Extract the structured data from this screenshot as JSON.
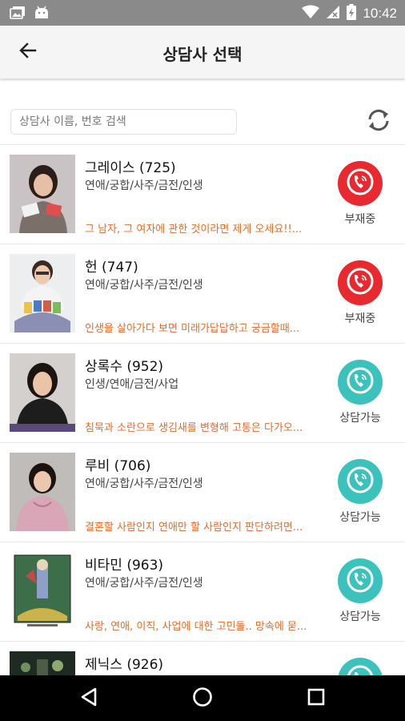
{
  "status_bar": {
    "time": "10:42",
    "icons": [
      "photo-icon",
      "android-icon",
      "wifi-icon",
      "signal-icon",
      "battery-icon"
    ]
  },
  "app_bar": {
    "title": "상담사 선택",
    "back_icon": "arrow-left-icon"
  },
  "search": {
    "placeholder": "상담사 이름, 번호 검색",
    "refresh_icon": "refresh-icon"
  },
  "colors": {
    "accent_orange": "#ea6a23",
    "status_red": "#e8292f",
    "status_teal": "#3cc2bc"
  },
  "counselors": [
    {
      "name": "그레이스 (725)",
      "categories": "연애/궁합/사주/금전/인생",
      "description": "그 남자, 그 여자에 관한 것이라면 제게 오세요!!...",
      "status": "부재중",
      "status_color": "red"
    },
    {
      "name": "헌 (747)",
      "categories": "연애/궁합/사주/금전/인생",
      "description": "인생을 살아가다 보면 미래가답답하고 궁금할때...",
      "status": "부재중",
      "status_color": "red"
    },
    {
      "name": "상록수 (952)",
      "categories": "인생/연애/금전/사업",
      "description": "침묵과 소란으로 생김새를 변형해 고통은 다가오...",
      "status": "상담가능",
      "status_color": "teal"
    },
    {
      "name": "루비 (706)",
      "categories": "연애/궁합/사주/금전/인생",
      "description": "결혼할 사람인지 연애만 할 사람인지 판단하려면...",
      "status": "상담가능",
      "status_color": "teal"
    },
    {
      "name": "비타민 (963)",
      "categories": "연애/궁합/사주/금전/인생",
      "description": "사랑, 연애, 이직, 사업에 대한 고민들.. 망속에 묻...",
      "status": "상담가능",
      "status_color": "teal"
    },
    {
      "name": "제닉스 (926)",
      "categories": "",
      "description": "",
      "status": "",
      "status_color": "teal"
    }
  ],
  "nav_bar": {
    "icons": [
      "back-triangle-icon",
      "home-circle-icon",
      "recents-square-icon"
    ]
  }
}
